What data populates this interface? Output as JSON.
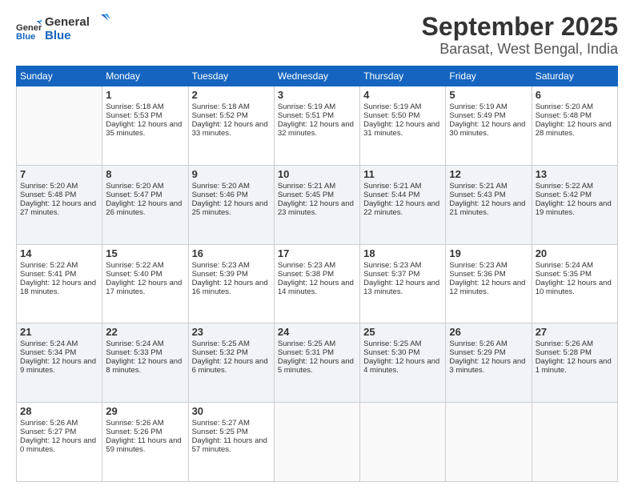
{
  "header": {
    "logo_line1": "General",
    "logo_line2": "Blue",
    "title": "September 2025",
    "subtitle": "Barasat, West Bengal, India"
  },
  "days_of_week": [
    "Sunday",
    "Monday",
    "Tuesday",
    "Wednesday",
    "Thursday",
    "Friday",
    "Saturday"
  ],
  "weeks": [
    [
      {
        "day": "",
        "sunrise": "",
        "sunset": "",
        "daylight": ""
      },
      {
        "day": "1",
        "sunrise": "Sunrise: 5:18 AM",
        "sunset": "Sunset: 5:53 PM",
        "daylight": "Daylight: 12 hours and 35 minutes."
      },
      {
        "day": "2",
        "sunrise": "Sunrise: 5:18 AM",
        "sunset": "Sunset: 5:52 PM",
        "daylight": "Daylight: 12 hours and 33 minutes."
      },
      {
        "day": "3",
        "sunrise": "Sunrise: 5:19 AM",
        "sunset": "Sunset: 5:51 PM",
        "daylight": "Daylight: 12 hours and 32 minutes."
      },
      {
        "day": "4",
        "sunrise": "Sunrise: 5:19 AM",
        "sunset": "Sunset: 5:50 PM",
        "daylight": "Daylight: 12 hours and 31 minutes."
      },
      {
        "day": "5",
        "sunrise": "Sunrise: 5:19 AM",
        "sunset": "Sunset: 5:49 PM",
        "daylight": "Daylight: 12 hours and 30 minutes."
      },
      {
        "day": "6",
        "sunrise": "Sunrise: 5:20 AM",
        "sunset": "Sunset: 5:48 PM",
        "daylight": "Daylight: 12 hours and 28 minutes."
      }
    ],
    [
      {
        "day": "7",
        "sunrise": "Sunrise: 5:20 AM",
        "sunset": "Sunset: 5:48 PM",
        "daylight": "Daylight: 12 hours and 27 minutes."
      },
      {
        "day": "8",
        "sunrise": "Sunrise: 5:20 AM",
        "sunset": "Sunset: 5:47 PM",
        "daylight": "Daylight: 12 hours and 26 minutes."
      },
      {
        "day": "9",
        "sunrise": "Sunrise: 5:20 AM",
        "sunset": "Sunset: 5:46 PM",
        "daylight": "Daylight: 12 hours and 25 minutes."
      },
      {
        "day": "10",
        "sunrise": "Sunrise: 5:21 AM",
        "sunset": "Sunset: 5:45 PM",
        "daylight": "Daylight: 12 hours and 23 minutes."
      },
      {
        "day": "11",
        "sunrise": "Sunrise: 5:21 AM",
        "sunset": "Sunset: 5:44 PM",
        "daylight": "Daylight: 12 hours and 22 minutes."
      },
      {
        "day": "12",
        "sunrise": "Sunrise: 5:21 AM",
        "sunset": "Sunset: 5:43 PM",
        "daylight": "Daylight: 12 hours and 21 minutes."
      },
      {
        "day": "13",
        "sunrise": "Sunrise: 5:22 AM",
        "sunset": "Sunset: 5:42 PM",
        "daylight": "Daylight: 12 hours and 19 minutes."
      }
    ],
    [
      {
        "day": "14",
        "sunrise": "Sunrise: 5:22 AM",
        "sunset": "Sunset: 5:41 PM",
        "daylight": "Daylight: 12 hours and 18 minutes."
      },
      {
        "day": "15",
        "sunrise": "Sunrise: 5:22 AM",
        "sunset": "Sunset: 5:40 PM",
        "daylight": "Daylight: 12 hours and 17 minutes."
      },
      {
        "day": "16",
        "sunrise": "Sunrise: 5:23 AM",
        "sunset": "Sunset: 5:39 PM",
        "daylight": "Daylight: 12 hours and 16 minutes."
      },
      {
        "day": "17",
        "sunrise": "Sunrise: 5:23 AM",
        "sunset": "Sunset: 5:38 PM",
        "daylight": "Daylight: 12 hours and 14 minutes."
      },
      {
        "day": "18",
        "sunrise": "Sunrise: 5:23 AM",
        "sunset": "Sunset: 5:37 PM",
        "daylight": "Daylight: 12 hours and 13 minutes."
      },
      {
        "day": "19",
        "sunrise": "Sunrise: 5:23 AM",
        "sunset": "Sunset: 5:36 PM",
        "daylight": "Daylight: 12 hours and 12 minutes."
      },
      {
        "day": "20",
        "sunrise": "Sunrise: 5:24 AM",
        "sunset": "Sunset: 5:35 PM",
        "daylight": "Daylight: 12 hours and 10 minutes."
      }
    ],
    [
      {
        "day": "21",
        "sunrise": "Sunrise: 5:24 AM",
        "sunset": "Sunset: 5:34 PM",
        "daylight": "Daylight: 12 hours and 9 minutes."
      },
      {
        "day": "22",
        "sunrise": "Sunrise: 5:24 AM",
        "sunset": "Sunset: 5:33 PM",
        "daylight": "Daylight: 12 hours and 8 minutes."
      },
      {
        "day": "23",
        "sunrise": "Sunrise: 5:25 AM",
        "sunset": "Sunset: 5:32 PM",
        "daylight": "Daylight: 12 hours and 6 minutes."
      },
      {
        "day": "24",
        "sunrise": "Sunrise: 5:25 AM",
        "sunset": "Sunset: 5:31 PM",
        "daylight": "Daylight: 12 hours and 5 minutes."
      },
      {
        "day": "25",
        "sunrise": "Sunrise: 5:25 AM",
        "sunset": "Sunset: 5:30 PM",
        "daylight": "Daylight: 12 hours and 4 minutes."
      },
      {
        "day": "26",
        "sunrise": "Sunrise: 5:26 AM",
        "sunset": "Sunset: 5:29 PM",
        "daylight": "Daylight: 12 hours and 3 minutes."
      },
      {
        "day": "27",
        "sunrise": "Sunrise: 5:26 AM",
        "sunset": "Sunset: 5:28 PM",
        "daylight": "Daylight: 12 hours and 1 minute."
      }
    ],
    [
      {
        "day": "28",
        "sunrise": "Sunrise: 5:26 AM",
        "sunset": "Sunset: 5:27 PM",
        "daylight": "Daylight: 12 hours and 0 minutes."
      },
      {
        "day": "29",
        "sunrise": "Sunrise: 5:26 AM",
        "sunset": "Sunset: 5:26 PM",
        "daylight": "Daylight: 11 hours and 59 minutes."
      },
      {
        "day": "30",
        "sunrise": "Sunrise: 5:27 AM",
        "sunset": "Sunset: 5:25 PM",
        "daylight": "Daylight: 11 hours and 57 minutes."
      },
      {
        "day": "",
        "sunrise": "",
        "sunset": "",
        "daylight": ""
      },
      {
        "day": "",
        "sunrise": "",
        "sunset": "",
        "daylight": ""
      },
      {
        "day": "",
        "sunrise": "",
        "sunset": "",
        "daylight": ""
      },
      {
        "day": "",
        "sunrise": "",
        "sunset": "",
        "daylight": ""
      }
    ]
  ]
}
